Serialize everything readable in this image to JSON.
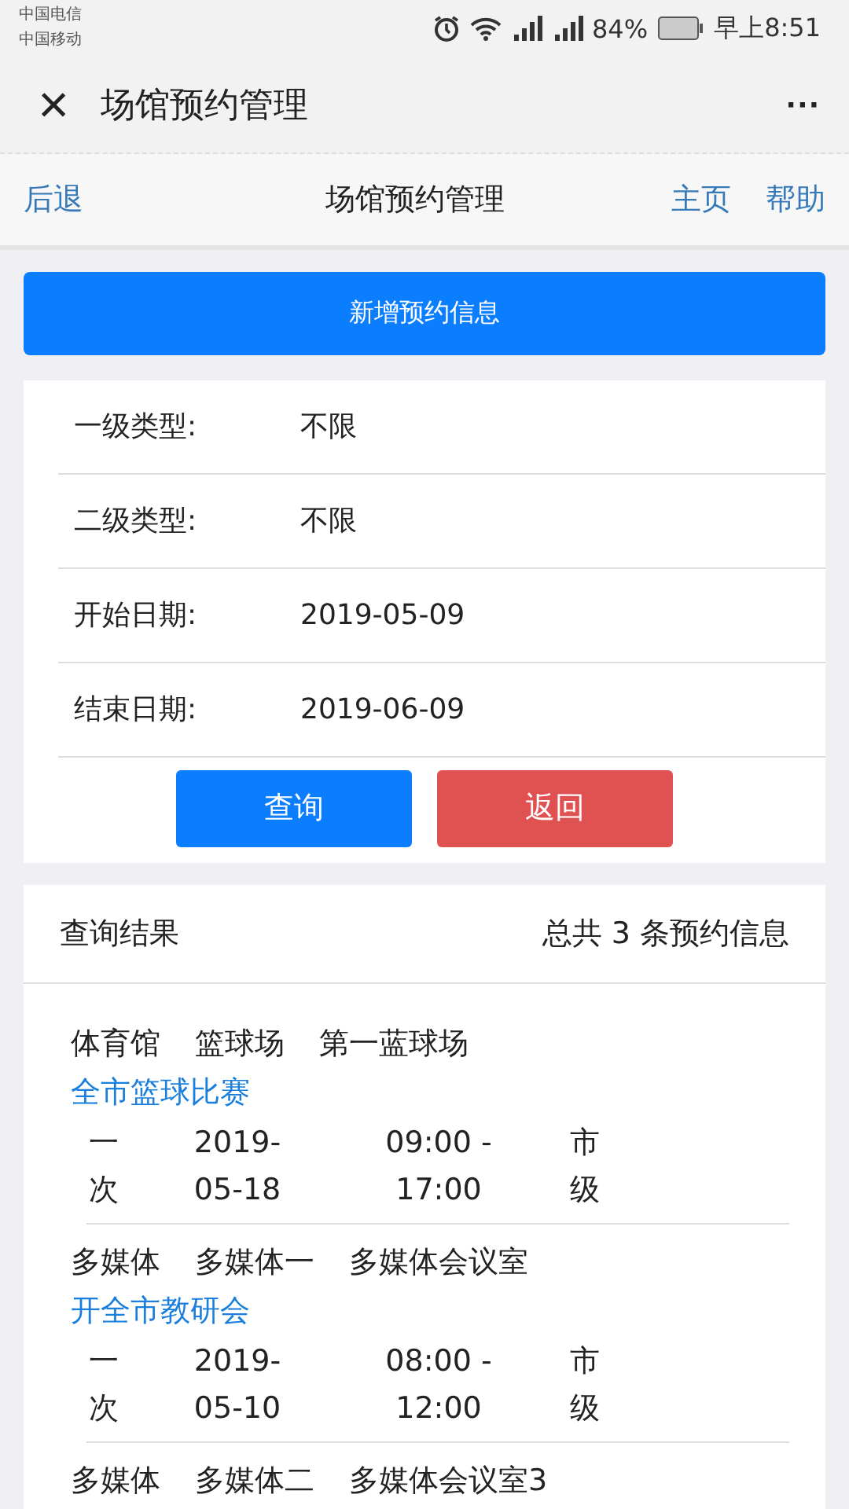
{
  "status_bar": {
    "carriers": [
      "中国电信",
      "中国移动"
    ],
    "battery_text": "84%",
    "time": "早上8:51"
  },
  "window": {
    "title": "场馆预约管理",
    "close": "×",
    "more": "···"
  },
  "nav": {
    "back": "后退",
    "title": "场馆预约管理",
    "links": [
      "主页",
      "帮助"
    ]
  },
  "add_button": "新增预约信息",
  "filters": [
    {
      "label": "一级类型:",
      "value": "不限"
    },
    {
      "label": "二级类型:",
      "value": "不限"
    },
    {
      "label": "开始日期:",
      "value": "2019-05-09"
    },
    {
      "label": "结束日期:",
      "value": "2019-06-09"
    }
  ],
  "buttons": [
    {
      "label": "查询",
      "kind": "primary"
    },
    {
      "label": "返回",
      "kind": "danger"
    }
  ],
  "results": {
    "title": "查询结果",
    "summary": "总共 3 条预约信息",
    "records": [
      {
        "venue": [
          "体育馆",
          "篮球场",
          "第一蓝球场"
        ],
        "event": "全市篮球比赛",
        "details": [
          "一次",
          "2019-05-18",
          "09:00 - 17:00",
          "市级"
        ]
      },
      {
        "venue": [
          "多媒体",
          "多媒体一",
          "多媒体会议室"
        ],
        "event": "开全市教研会",
        "details": [
          "一次",
          "2019-05-10",
          "08:00 - 12:00",
          "市级"
        ]
      },
      {
        "venue": [
          "多媒体",
          "多媒体二",
          "多媒体会议室3"
        ]
      }
    ]
  }
}
